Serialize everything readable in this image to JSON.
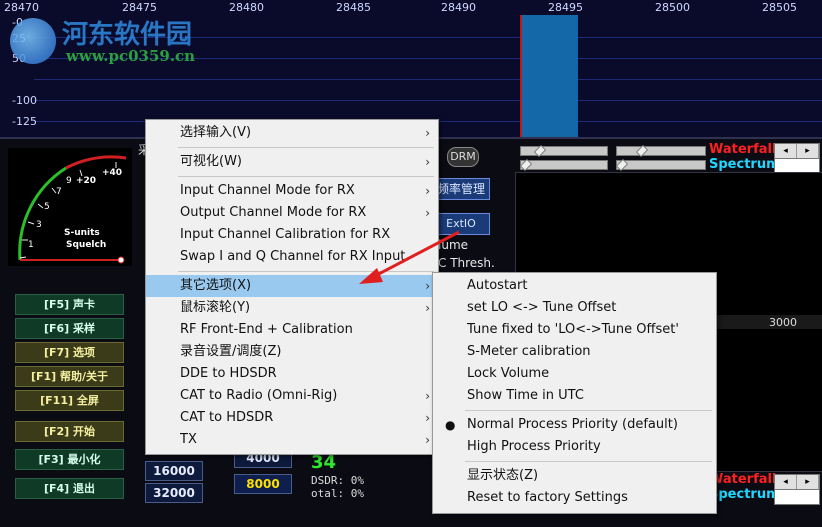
{
  "spectrum": {
    "freq_ticks": [
      "28470",
      "28475",
      "28480",
      "28485",
      "28490",
      "28495",
      "28500",
      "28505"
    ],
    "db_ticks": [
      "-25",
      "-50",
      "-100",
      "-125"
    ],
    "db_ticks_top": [
      "-0",
      "25",
      "50"
    ]
  },
  "watermark": {
    "title": "河东软件园",
    "url": "www.pc0359.cn"
  },
  "meter": {
    "scale_labels": [
      "1",
      "3",
      "5",
      "7",
      "9",
      "+20",
      "+40"
    ],
    "caption_line1": "S-units",
    "caption_line2": "Squelch"
  },
  "function_keys": [
    {
      "label": "[F5] 声卡"
    },
    {
      "label": "[F6] 采样"
    },
    {
      "label": "[F7] 选项"
    },
    {
      "label": "[F1] 帮助/关于"
    },
    {
      "label": "[F11] 全屏"
    },
    {
      "label": "[F2] 开始"
    },
    {
      "label": "[F3] 最小化"
    },
    {
      "label": "[F4] 退出"
    }
  ],
  "controls": {
    "drm": "DRM",
    "freq_mgr": "频率管理",
    "extio": "ExtIO",
    "volume_label": "lume",
    "thresh_label": "C Thresh.",
    "waterfall": "Waterfall",
    "spectrum": "Spectrum",
    "wf_scale": "3000",
    "rates": [
      "4000",
      "16000",
      "8000",
      "32000"
    ],
    "level": "34",
    "stat1": "DSDR: 0%",
    "stat2": "otal: 0%",
    "partial_char": "采"
  },
  "context_menu": {
    "items": [
      {
        "label": "选择输入(V)",
        "submenu": true
      },
      {
        "label": "可视化(W)",
        "submenu": true
      },
      {
        "label": "Input Channel Mode for RX",
        "submenu": true
      },
      {
        "label": "Output Channel Mode for RX",
        "submenu": true
      },
      {
        "label": "Input Channel Calibration for RX",
        "submenu": false
      },
      {
        "label": "Swap I and Q Channel for RX Input",
        "submenu": false
      },
      {
        "label": "其它选项(X)",
        "submenu": true,
        "highlighted": true
      },
      {
        "label": "鼠标滚轮(Y)",
        "submenu": true
      },
      {
        "label": "RF Front-End + Calibration",
        "submenu": false
      },
      {
        "label": "录音设置/调度(Z)",
        "submenu": false
      },
      {
        "label": "DDE to HDSDR",
        "submenu": false
      },
      {
        "label": "CAT to Radio (Omni-Rig)",
        "submenu": true
      },
      {
        "label": "CAT to HDSDR",
        "submenu": true
      },
      {
        "label": "TX",
        "submenu": true
      }
    ],
    "arrow_glyph": "›"
  },
  "submenu": {
    "items": [
      {
        "label": "Autostart"
      },
      {
        "label": "set LO <-> Tune Offset"
      },
      {
        "label": "Tune fixed to 'LO<->Tune Offset'"
      },
      {
        "label": "S-Meter calibration"
      },
      {
        "label": "Lock Volume"
      },
      {
        "label": "Show Time in UTC"
      },
      {
        "label": "Normal Process Priority (default)",
        "checked": true
      },
      {
        "label": "High Process Priority"
      },
      {
        "label": "显示状态(Z)"
      },
      {
        "label": "Reset to factory Settings"
      }
    ],
    "bullet": "●"
  },
  "colors": {
    "menu_highlight": "#99c9ef",
    "waterfall_label": "#ff2020",
    "spectrum_label": "#20d8ff",
    "annotation_arrow": "#e02020"
  }
}
